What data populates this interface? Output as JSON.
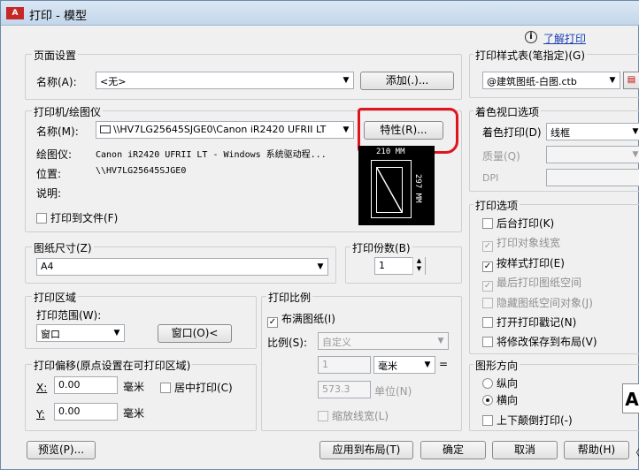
{
  "window": {
    "app_icon": "A",
    "title": "打印 - 模型"
  },
  "help_link": "了解打印",
  "page_setup": {
    "group": "页面设置",
    "name_label": "名称(A):",
    "name_value": "<无>",
    "add_button": "添加(.)..."
  },
  "printer": {
    "group": "打印机/绘图仪",
    "name_label": "名称(M):",
    "name_value": "\\\\HV7LG25645SJGE0\\Canon iR2420 UFRII LT",
    "properties_button": "特性(R)...",
    "plotter_label": "绘图仪:",
    "plotter_value": "Canon iR2420 UFRII LT - Windows 系统驱动程...",
    "location_label": "位置:",
    "location_value": "\\\\HV7LG25645SJGE0",
    "description_label": "说明:",
    "print_to_file": "打印到文件(F)",
    "preview_width": "210 MM",
    "preview_height": "297 MM"
  },
  "paper_size": {
    "group": "图纸尺寸(Z)",
    "value": "A4"
  },
  "copies": {
    "group": "打印份数(B)",
    "value": "1"
  },
  "plot_area": {
    "group": "打印区域",
    "range_label": "打印范围(W):",
    "range_value": "窗口",
    "window_button": "窗口(O)<"
  },
  "plot_offset": {
    "group": "打印偏移(原点设置在可打印区域)",
    "x_label": "X:",
    "x_value": "0.00",
    "x_unit": "毫米",
    "y_label": "Y:",
    "y_value": "0.00",
    "y_unit": "毫米",
    "center": "居中打印(C)"
  },
  "plot_scale": {
    "group": "打印比例",
    "fit": "布满图纸(I)",
    "scale_label": "比例(S):",
    "scale_value": "自定义",
    "value1": "1",
    "unit1": "毫米",
    "equals": "=",
    "value2": "573.3",
    "unit2": "单位(N)",
    "lineweights": "缩放线宽(L)"
  },
  "plot_style_table": {
    "group": "打印样式表(笔指定)(G)",
    "value": "@建筑图纸-白图.ctb"
  },
  "shaded_viewport": {
    "group": "着色视口选项",
    "shade_label": "着色打印(D)",
    "shade_value": "线框",
    "quality_label": "质量(Q)",
    "dpi_label": "DPI"
  },
  "plot_options": {
    "group": "打印选项",
    "background": "后台打印(K)",
    "object_lineweights": "打印对象线宽",
    "plot_styles": "按样式打印(E)",
    "paperspace_last": "最后打印图纸空间",
    "hide_objects": "隐藏图纸空间对象(J)",
    "stamp": "打开打印戳记(N)",
    "save_layout": "将修改保存到布局(V)"
  },
  "orientation": {
    "group": "图形方向",
    "portrait": "纵向",
    "landscape": "横向",
    "upside_down": "上下颠倒打印(-)",
    "preview_glyph": "A"
  },
  "buttons": {
    "preview": "预览(P)...",
    "apply": "应用到布局(T)",
    "ok": "确定",
    "cancel": "取消",
    "help": "帮助(H)"
  },
  "colors": {
    "annotation_red": "#e0141e"
  }
}
